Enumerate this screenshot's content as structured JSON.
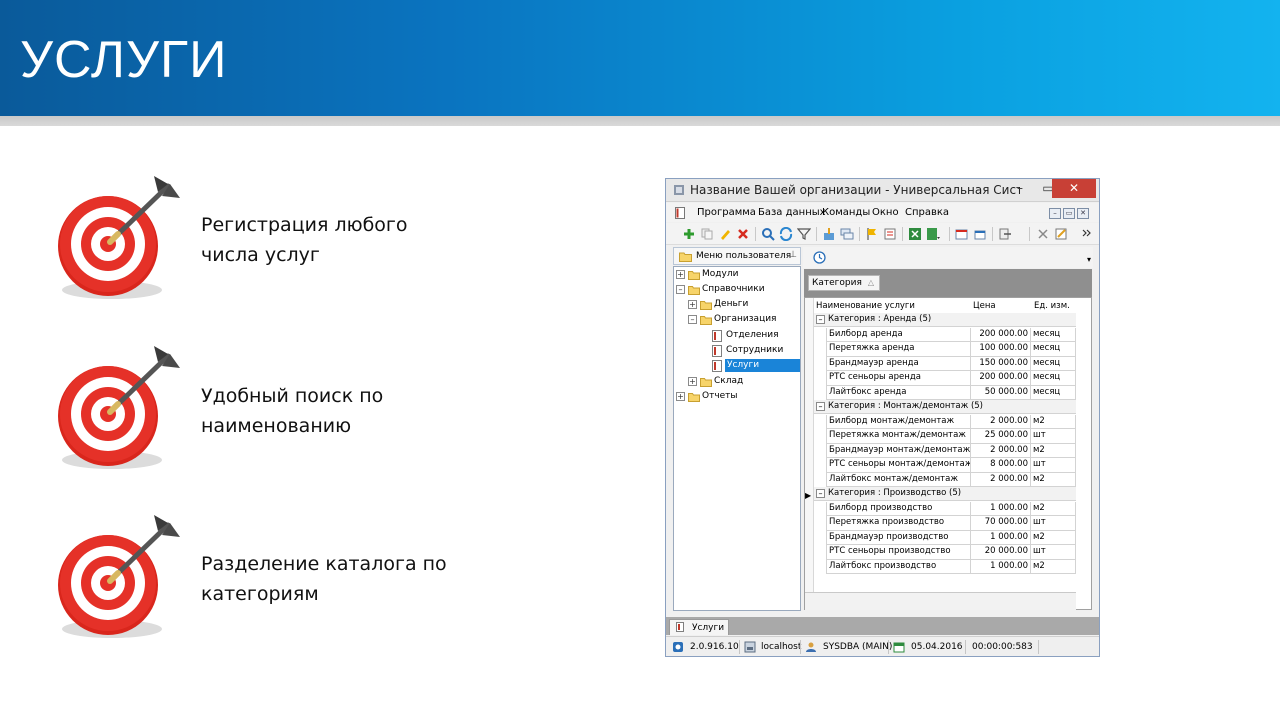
{
  "slide": {
    "title": "УСЛУГИ",
    "bullets": [
      {
        "line1": "Регистрация любого",
        "line2": "числа услуг",
        "icon": "target-icon"
      },
      {
        "line1": "Удобный поиск по",
        "line2": "наименованию",
        "icon": "target-icon"
      },
      {
        "line1": "Разделение каталога по",
        "line2": "категориям",
        "icon": "target-icon"
      }
    ]
  },
  "window": {
    "title": "Название Вашей организации - Универсальная Систем…",
    "controls": {
      "minimize": "–",
      "maximize": "▭",
      "close": "✕"
    },
    "menu": [
      "Программа",
      "База данных",
      "Команды",
      "Окно",
      "Справка"
    ],
    "left_panel": {
      "header": "Меню пользователя",
      "tree": [
        {
          "label": "Модули",
          "expander": "+"
        },
        {
          "label": "Справочники",
          "expander": "–"
        },
        {
          "label": "Деньги",
          "expander": "+"
        },
        {
          "label": "Организация",
          "expander": "–"
        },
        {
          "label": "Отделения"
        },
        {
          "label": "Сотрудники"
        },
        {
          "label": "Услуги",
          "selected": true
        },
        {
          "label": "Склад",
          "expander": "+"
        },
        {
          "label": "Отчеты",
          "expander": "+"
        }
      ]
    },
    "grid": {
      "group_by": "Категория",
      "sort_glyph": "△",
      "columns": [
        "Наименование услуги",
        "Цена",
        "Ед. изм."
      ],
      "groups": [
        {
          "label": "Категория : Аренда (5)",
          "rows": [
            [
              "Билборд аренда",
              "200 000.00",
              "месяц"
            ],
            [
              "Перетяжка аренда",
              "100 000.00",
              "месяц"
            ],
            [
              "Брандмауэр аренда",
              "150 000.00",
              "месяц"
            ],
            [
              "РТС сеньоры аренда",
              "200 000.00",
              "месяц"
            ],
            [
              "Лайтбокс аренда",
              "50 000.00",
              "месяц"
            ]
          ]
        },
        {
          "label": "Категория : Монтаж/демонтаж (5)",
          "rows": [
            [
              "Билборд монтаж/демонтаж",
              "2 000.00",
              "м2"
            ],
            [
              "Перетяжка монтаж/демонтаж",
              "25 000.00",
              "шт"
            ],
            [
              "Брандмауэр монтаж/демонтаж",
              "2 000.00",
              "м2"
            ],
            [
              "РТС сеньоры монтаж/демонтаж",
              "8 000.00",
              "шт"
            ],
            [
              "Лайтбокс монтаж/демонтаж",
              "2 000.00",
              "м2"
            ]
          ]
        },
        {
          "label": "Категория : Производство (5)",
          "rows": [
            [
              "Билборд производство",
              "1 000.00",
              "м2"
            ],
            [
              "Перетяжка производство",
              "70 000.00",
              "шт"
            ],
            [
              "Брандмауэр производство",
              "1 000.00",
              "м2"
            ],
            [
              "РТС сеньоры производство",
              "20 000.00",
              "шт"
            ],
            [
              "Лайтбокс производство",
              "1 000.00",
              "м2"
            ]
          ]
        }
      ]
    },
    "tab": "Услуги",
    "status": {
      "version": "2.0.916.10",
      "server": "localhost",
      "user": "SYSDBA (MAIN)",
      "date": "05.04.2016",
      "timer": "00:00:00:583"
    }
  }
}
